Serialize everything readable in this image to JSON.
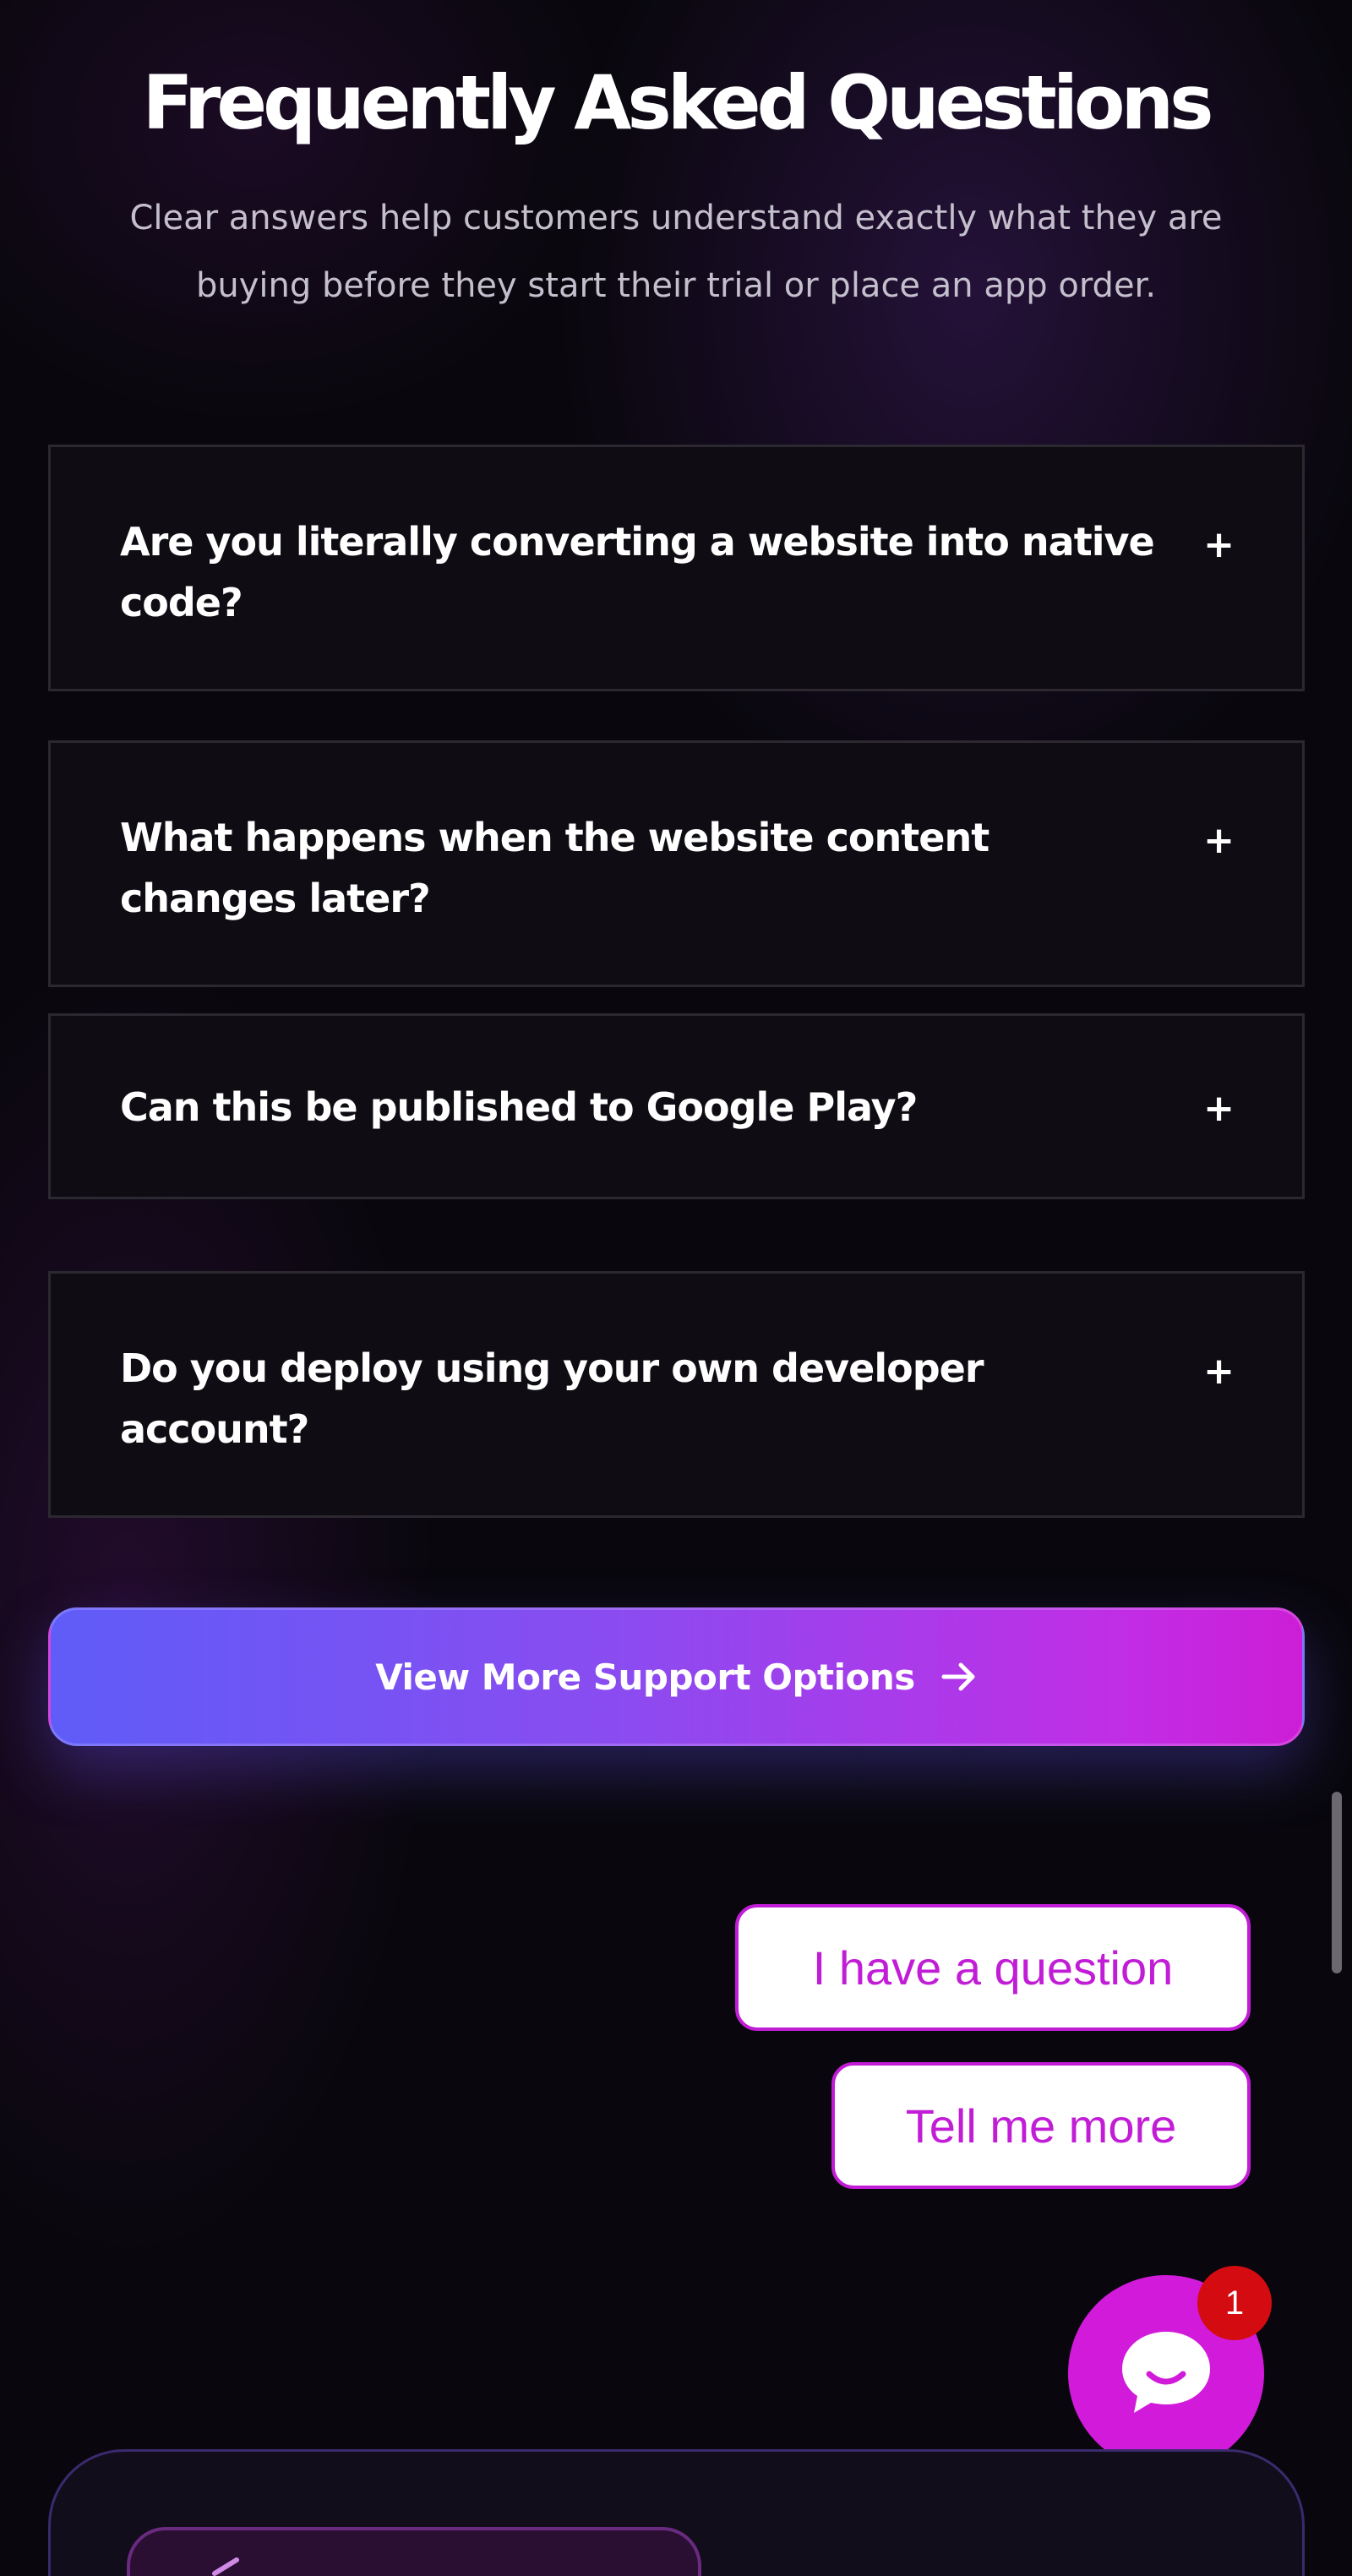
{
  "faq": {
    "title": "Frequently Asked Questions",
    "subtitle_line1": "Clear answers help customers understand exactly what they are",
    "subtitle_line2": "buying before they start their trial or place an app order.",
    "items": [
      {
        "question": "Are you literally converting a website into native code?",
        "line1": "Are you literally converting a website into native",
        "line2": "code?",
        "toggle": "+"
      },
      {
        "question": "What happens when the website content changes later?",
        "line1": "What happens when the website content",
        "line2": "changes later?",
        "toggle": "+"
      },
      {
        "question": "Can this be published to Google Play?",
        "line1": "Can this be published to Google Play?",
        "line2": "",
        "toggle": "+"
      },
      {
        "question": "Do you deploy using your own developer account?",
        "line1": "Do you deploy using your own developer",
        "line2": "account?",
        "toggle": "+"
      }
    ]
  },
  "cta": {
    "label": "View More Support Options",
    "icon": "arrow-right-icon"
  },
  "chat": {
    "suggestions": [
      "I have a question",
      "Tell me more"
    ],
    "launcher_icon": "chat-bubble-icon",
    "badge_count": "1"
  },
  "colors": {
    "background": "#09070d",
    "accent_magenta": "#c21dd6",
    "gradient_start": "#5f5cf8",
    "gradient_end": "#cc1ed6",
    "badge_red": "#d40b10"
  }
}
